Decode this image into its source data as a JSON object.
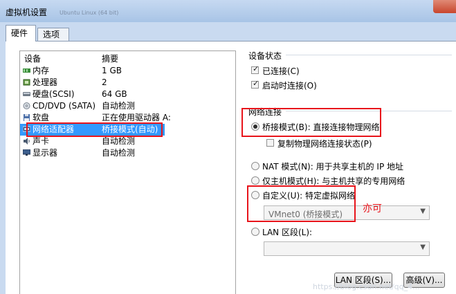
{
  "window": {
    "title": "虚拟机设置",
    "blurred_tab": "Ubuntu Linux (64 bit)"
  },
  "tabs": [
    {
      "label": "硬件"
    },
    {
      "label": "选项"
    }
  ],
  "device_list": {
    "headers": {
      "device": "设备",
      "summary": "摘要"
    },
    "items": [
      {
        "name": "内存",
        "summary": "1 GB",
        "icon": "memory-icon"
      },
      {
        "name": "处理器",
        "summary": "2",
        "icon": "processor-icon"
      },
      {
        "name": "硬盘(SCSI)",
        "summary": "64 GB",
        "icon": "harddisk-icon"
      },
      {
        "name": "CD/DVD (SATA)",
        "summary": "自动检测",
        "icon": "cd-dvd-icon"
      },
      {
        "name": "软盘",
        "summary": "正在使用驱动器 A:",
        "icon": "floppy-icon"
      },
      {
        "name": "网络适配器",
        "summary": "桥接模式(自动)",
        "icon": "network-adapter-icon",
        "selected": true
      },
      {
        "name": "声卡",
        "summary": "自动检测",
        "icon": "sound-card-icon"
      },
      {
        "name": "显示器",
        "summary": "自动检测",
        "icon": "display-icon"
      }
    ]
  },
  "device_status": {
    "label": "设备状态",
    "connected": {
      "label": "已连接(C)",
      "checked": true
    },
    "connect_at_power_on": {
      "label": "启动时连接(O)",
      "checked": true
    }
  },
  "network_connection": {
    "label": "网络连接",
    "bridged": {
      "label": "桥接模式(B): 直接连接物理网络",
      "selected": true
    },
    "replicate": {
      "label": "复制物理网络连接状态(P)",
      "checked": false
    },
    "nat": {
      "label": "NAT 模式(N): 用于共享主机的 IP 地址",
      "selected": false
    },
    "host_only": {
      "label": "仅主机模式(H): 与主机共享的专用网络",
      "selected": false
    },
    "custom": {
      "label": "自定义(U): 特定虚拟网络",
      "selected": false,
      "value": "VMnet0 (桥接模式)"
    },
    "lan_segment": {
      "label": "LAN 区段(L):",
      "selected": false,
      "value": ""
    }
  },
  "buttons": {
    "lan_segments": "LAN 区段(S)...",
    "advanced": "高级(V)..."
  },
  "annotation": "亦可",
  "watermark": "https://blog.csdn.net/qq_4..."
}
